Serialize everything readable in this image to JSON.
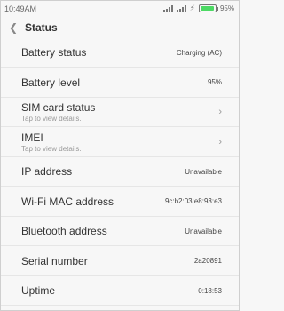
{
  "status_bar": {
    "time": "10:49AM",
    "battery_percent": "95%",
    "battery_level": 0.95,
    "icons": [
      "signal-icon",
      "signal-icon",
      "charging-icon",
      "battery-icon"
    ]
  },
  "header": {
    "back_icon": "chevron-left-icon",
    "title": "Status"
  },
  "rows": [
    {
      "label": "Battery status",
      "value": "Charging (AC)"
    },
    {
      "label": "Battery level",
      "value": "95%"
    },
    {
      "label": "SIM card status",
      "sub": "Tap to view details.",
      "chevron": "chevron-right-icon"
    },
    {
      "label": "IMEI",
      "sub": "Tap to view details.",
      "chevron": "chevron-right-icon"
    },
    {
      "label": "IP address",
      "value": "Unavailable"
    },
    {
      "label": "Wi-Fi MAC address",
      "value": "9c:b2:03:e8:93:e3"
    },
    {
      "label": "Bluetooth address",
      "value": "Unavailable"
    },
    {
      "label": "Serial number",
      "value": "2a20891"
    },
    {
      "label": "Uptime",
      "value": "0:18:53"
    }
  ],
  "colors": {
    "battery_fill": "#4cd964",
    "background": "#f7f7f7"
  }
}
